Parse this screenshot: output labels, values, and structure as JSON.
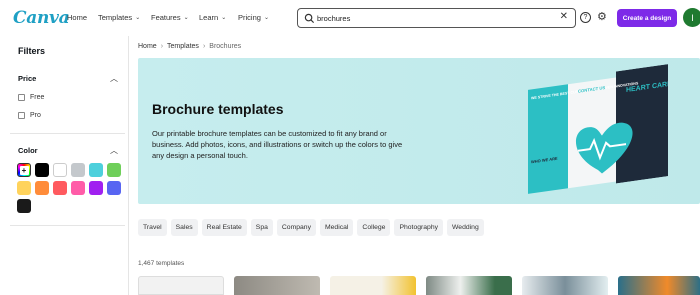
{
  "header": {
    "logo": "Canva",
    "nav": [
      {
        "label": "Home",
        "has_chevron": false
      },
      {
        "label": "Templates",
        "has_chevron": true
      },
      {
        "label": "Features",
        "has_chevron": true
      },
      {
        "label": "Learn",
        "has_chevron": true
      },
      {
        "label": "Pricing",
        "has_chevron": true
      }
    ],
    "search": {
      "value": "brochures",
      "icon": "search-icon"
    },
    "create_label": "Create a design",
    "avatar_initial": "I",
    "colors": {
      "create": "#7d2ae8",
      "avatar": "#1f7a30",
      "logo": "#1fa0c4"
    }
  },
  "sidebar": {
    "title": "Filters",
    "price": {
      "title": "Price",
      "options": [
        "Free",
        "Pro"
      ]
    },
    "color": {
      "title": "Color",
      "swatches": [
        "multicolor",
        "#000000",
        "#ffffff",
        "#c4c8cc",
        "#4dd0dc",
        "#6fcf5a",
        "#ffd35c",
        "#ff8c3a",
        "#ff5a5f",
        "#ff5ca8",
        "#a020f0",
        "#5865f2",
        "#1a1a1a"
      ]
    }
  },
  "breadcrumb": [
    "Home",
    "Templates",
    "Brochures"
  ],
  "hero": {
    "title": "Brochure templates",
    "description": "Our printable brochure templates can be customized to fit any brand or business. Add photos, icons, and illustrations or switch up the colors to give any design a personal touch.",
    "brochure": {
      "left_heading": "WE STRIVE THE BEST CURRENT AND PROVEN INNOVATIONS",
      "left_sub": "WHO WE ARE",
      "mid_heading": "CONTACT US",
      "right_heading": "HEART CARE"
    }
  },
  "tags": [
    "Travel",
    "Sales",
    "Real Estate",
    "Spa",
    "Company",
    "Medical",
    "College",
    "Photography",
    "Wedding"
  ],
  "results_count": "1,467 templates"
}
